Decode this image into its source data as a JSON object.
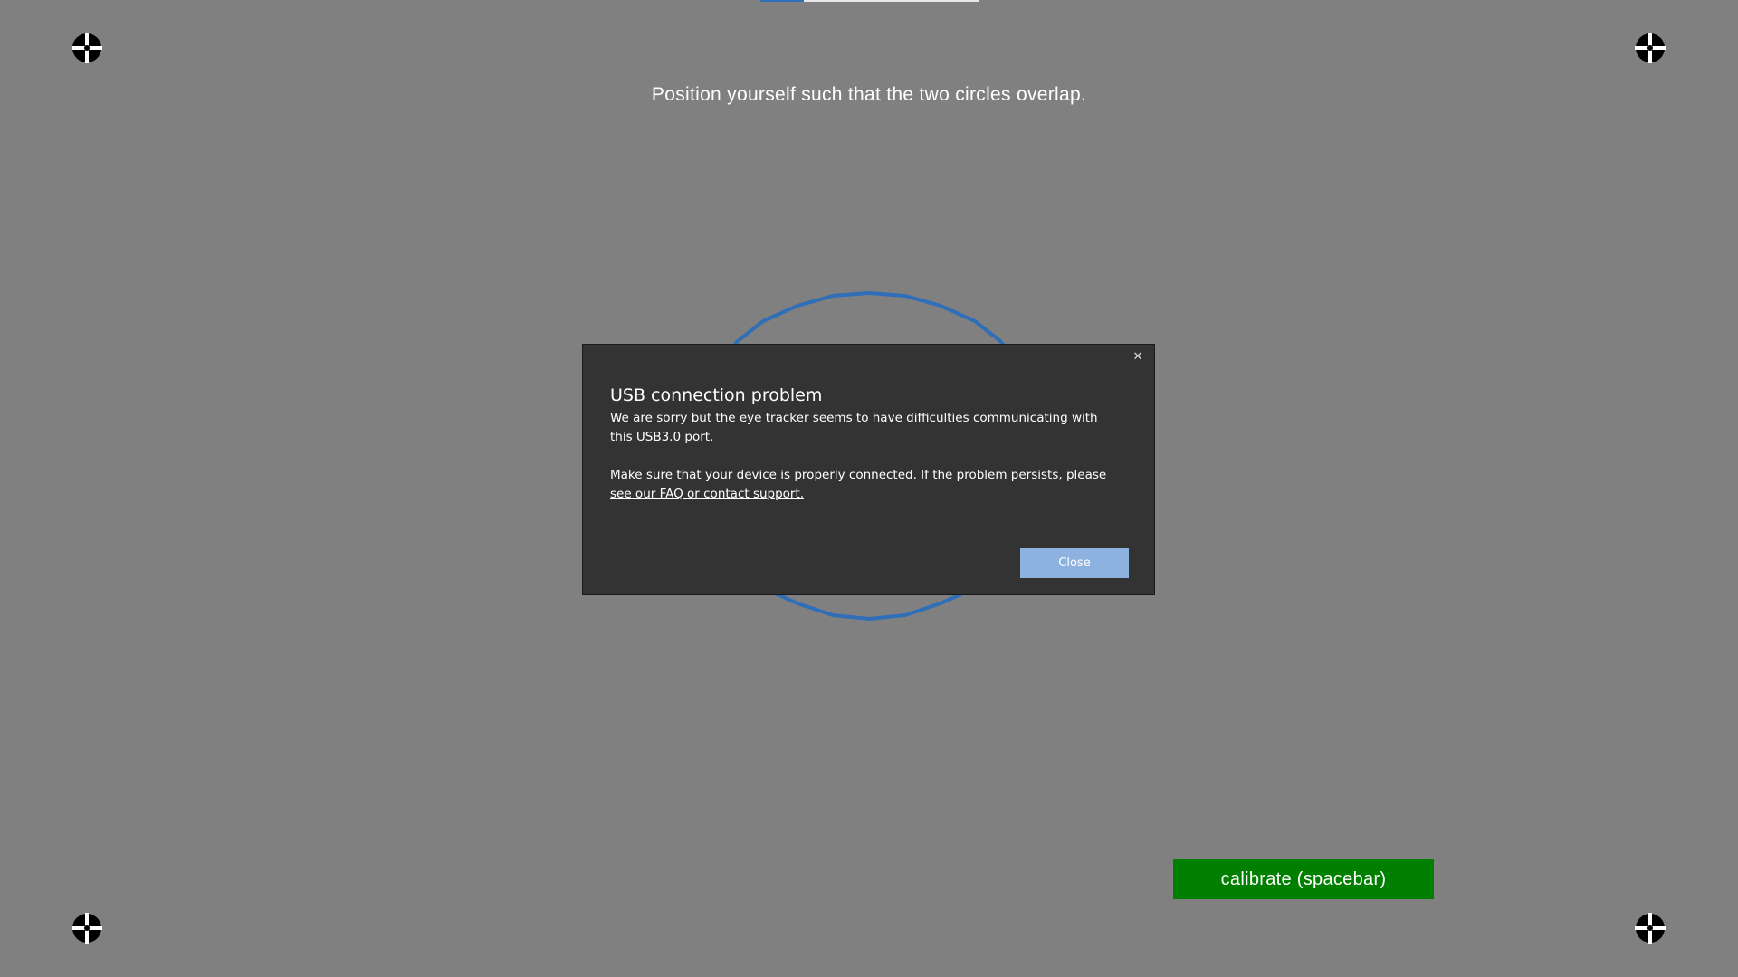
{
  "screen": {
    "instruction": "Position yourself such that the two circles overlap.",
    "calibrate_label": "calibrate (spacebar)"
  },
  "dialog": {
    "title": "USB connection problem",
    "message_line1": "We are sorry but the eye tracker seems to have difficulties communicating with this USB3.0 port.",
    "message_line2_prefix": "Make sure that your device is properly connected. If the problem persists, please ",
    "link_text": "see our FAQ or contact support.",
    "close_button_label": "Close",
    "close_icon": "close-icon"
  },
  "colors": {
    "background": "#808080",
    "circle": "#2f6fb8",
    "calibrate_button": "#007f00",
    "dialog_background": "#333333",
    "dialog_button": "#8eb2e0"
  },
  "icons": {
    "fixation": "fixation-target-icon"
  }
}
